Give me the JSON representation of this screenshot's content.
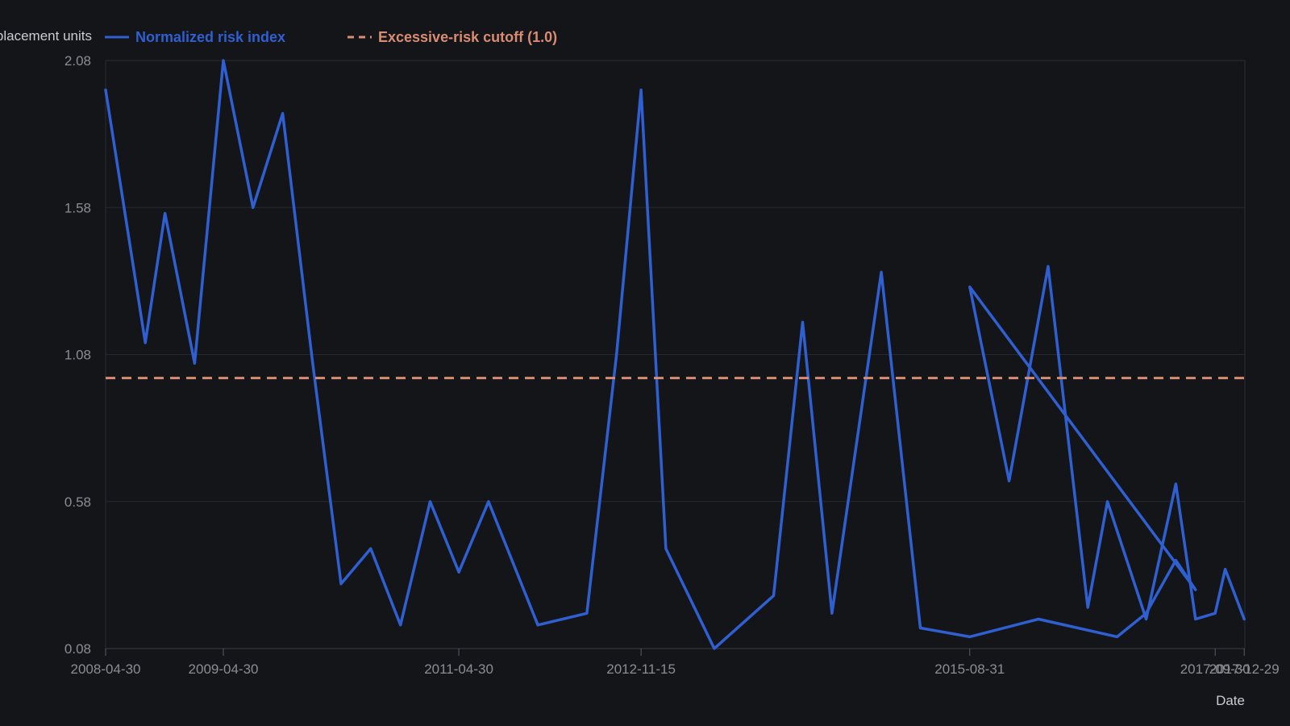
{
  "chart_data": {
    "type": "line",
    "ylabel": "Replacement units",
    "xlabel": "Date",
    "yticks": [
      "0.08",
      "0.58",
      "1.08",
      "1.58",
      "2.08"
    ],
    "ylim": [
      0.08,
      2.08
    ],
    "xlim": [
      "2008-04-30",
      "2017-12-31"
    ],
    "xticks": [
      "2008-04-30",
      "2009-04-30",
      "2011-04-30",
      "2012-11-15",
      "2015-08-31",
      "2017-09-30",
      "2017-12-29"
    ],
    "grid": true,
    "legend_position": "top-left",
    "series": [
      {
        "name": "Normalized risk index",
        "color": "#2f5fd0",
        "points": [
          [
            "2008-04-30",
            1.98
          ],
          [
            "2008-08-31",
            1.12
          ],
          [
            "2008-10-31",
            1.56
          ],
          [
            "2009-01-31",
            1.05
          ],
          [
            "2009-04-30",
            2.08
          ],
          [
            "2009-07-31",
            1.58
          ],
          [
            "2009-10-31",
            1.9
          ],
          [
            "2010-01-31",
            1.06
          ],
          [
            "2010-04-30",
            0.3
          ],
          [
            "2010-07-31",
            0.42
          ],
          [
            "2010-10-31",
            0.16
          ],
          [
            "2011-01-31",
            0.58
          ],
          [
            "2011-04-30",
            0.34
          ],
          [
            "2011-07-31",
            0.58
          ],
          [
            "2011-12-31",
            0.16
          ],
          [
            "2012-05-31",
            0.2
          ],
          [
            "2012-08-31",
            1.08
          ],
          [
            "2012-11-15",
            1.98
          ],
          [
            "2013-01-31",
            0.42
          ],
          [
            "2013-06-30",
            0.08
          ],
          [
            "2013-12-31",
            0.26
          ],
          [
            "2014-03-31",
            1.19
          ],
          [
            "2014-06-30",
            0.2
          ],
          [
            "2014-11-30",
            1.36
          ],
          [
            "2015-03-31",
            0.15
          ],
          [
            "2015-08-31",
            0.12
          ],
          [
            "2016-03-31",
            0.18
          ],
          [
            "2016-11-30",
            0.12
          ],
          [
            "2017-02-28",
            0.2
          ],
          [
            "2017-05-31",
            0.38
          ],
          [
            "2017-07-31",
            0.28
          ],
          [
            "2015-08-31",
            1.31
          ],
          [
            "2015-12-31",
            0.65
          ],
          [
            "2016-04-30",
            1.38
          ],
          [
            "2016-08-31",
            0.22
          ],
          [
            "2016-10-31",
            0.58
          ],
          [
            "2017-02-28",
            0.18
          ],
          [
            "2017-05-31",
            0.64
          ],
          [
            "2017-07-31",
            0.18
          ],
          [
            "2017-09-30",
            0.2
          ],
          [
            "2017-10-31",
            0.35
          ],
          [
            "2017-12-29",
            0.18
          ]
        ]
      },
      {
        "name": "Excessive-risk cutoff (1.0)",
        "color": "#d98c72",
        "dashed": true,
        "y": 1.0
      }
    ]
  }
}
